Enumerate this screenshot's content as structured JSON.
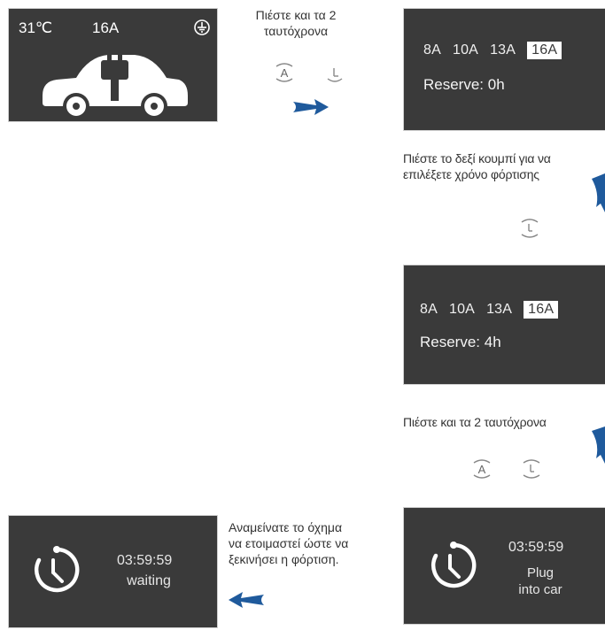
{
  "panel1": {
    "temperature": "31℃",
    "current": "16A",
    "ground_icon": "ground-icon",
    "car_icon": "car-plug-icon"
  },
  "step1_caption": "Πιέστε και τα 2\nταυτόχρονα",
  "panel2": {
    "amps": [
      "8A",
      "10A",
      "13A",
      "16A"
    ],
    "selected": "16A",
    "reserve": "Reserve: 0h"
  },
  "step2_caption": "Πιέστε το δεξί κουμπί για να\nεπιλέξετε χρόνο φόρτισης",
  "panel3": {
    "amps": [
      "8A",
      "10A",
      "13A",
      "16A"
    ],
    "selected": "16A",
    "reserve": "Reserve: 4h"
  },
  "step3_caption": "Πιέστε και τα 2 ταυτόχρονα",
  "panel4": {
    "time": "03:59:59",
    "status_line1": "Plug",
    "status_line2": "into car"
  },
  "step4_caption": "Αναμείνατε το όχημα\nνα ετοιμαστεί ώστε να\nξεκινήσει η φόρτιση.",
  "panel5": {
    "time": "03:59:59",
    "status": "waiting"
  },
  "colors": {
    "screen_bg": "#3a3a3a",
    "arrow_blue": "#1f5a9c",
    "text_dark": "#333333"
  }
}
